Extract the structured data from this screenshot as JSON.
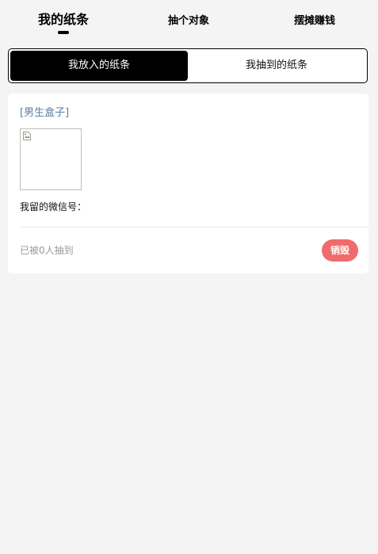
{
  "nav": {
    "mine": "我的纸条",
    "draw": "抽个对象",
    "stall": "摆摊赚钱"
  },
  "segment": {
    "put": "我放入的纸条",
    "drawn": "我抽到的纸条"
  },
  "card": {
    "box_type": "[男生盒子]",
    "wechat_label": "我留的微信号：",
    "drawn_count": "已被0人抽到",
    "destroy_label": "销毁"
  },
  "colors": {
    "accent": "#000000",
    "link": "#5b7fa8",
    "destroy": "#f06b6b",
    "background": "#f4f4f4"
  }
}
